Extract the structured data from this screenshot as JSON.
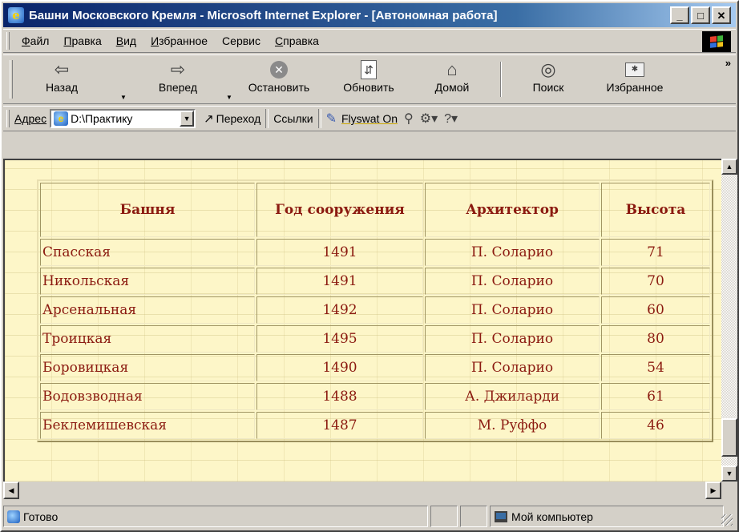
{
  "window": {
    "title": "Башни Московского Кремля - Microsoft Internet Explorer - [Автономная работа]",
    "minimize": "_",
    "maximize": "□",
    "close": "✕"
  },
  "menu": [
    {
      "underline": "Ф",
      "rest": "айл"
    },
    {
      "underline": "П",
      "rest": "равка"
    },
    {
      "underline": "В",
      "rest": "ид"
    },
    {
      "underline": "И",
      "rest": "збранное"
    },
    {
      "underline": "С",
      "rest": "ервис"
    },
    {
      "underline": "С",
      "rest": "правка"
    }
  ],
  "toolbar": {
    "back": "Назад",
    "forward": "Вперед",
    "stop": "Остановить",
    "refresh": "Обновить",
    "home": "Домой",
    "search": "Поиск",
    "favorites": "Избранное",
    "more": "»"
  },
  "address": {
    "label": "Адрес",
    "value": "D:\\Практику",
    "go": "Переход",
    "links": "Ссылки",
    "flyswat": "Flyswat On"
  },
  "table": {
    "headers": [
      "Башня",
      "Год сооружения",
      "Архитектор",
      "Высота"
    ],
    "rows": [
      [
        "Спасская",
        "1491",
        "П. Соларио",
        "71"
      ],
      [
        "Никольская",
        "1491",
        "П. Соларио",
        "70"
      ],
      [
        "Арсенальная",
        "1492",
        "П. Соларио",
        "60"
      ],
      [
        "Троицкая",
        "1495",
        "П. Соларио",
        "80"
      ],
      [
        "Боровицкая",
        "1490",
        "П. Соларио",
        "54"
      ],
      [
        "Водовзводная",
        "1488",
        "А. Джиларди",
        "61"
      ],
      [
        "Беклемишевская",
        "1487",
        "М. Руффо",
        "46"
      ]
    ]
  },
  "status": {
    "left": "Готово",
    "zone": "Мой компьютер"
  },
  "colors": {
    "title_start": "#0a246a",
    "table_text": "#8b1a10",
    "page_bg": "#fdf6c8"
  }
}
